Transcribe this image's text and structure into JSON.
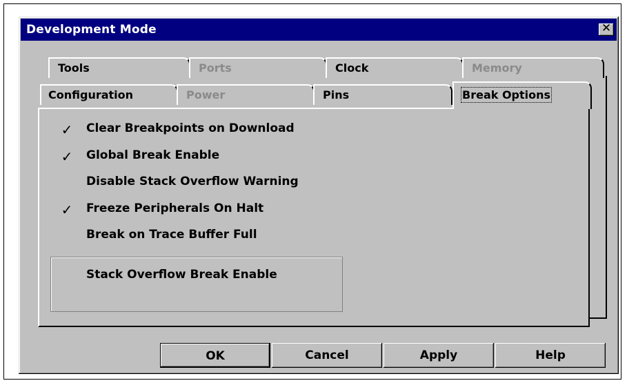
{
  "dialog": {
    "title": "Development Mode",
    "close_glyph": "✕"
  },
  "tabs": {
    "back_row": [
      {
        "label": "Tools",
        "enabled": true
      },
      {
        "label": "Ports",
        "enabled": false
      },
      {
        "label": "Clock",
        "enabled": true
      },
      {
        "label": "Memory",
        "enabled": false
      }
    ],
    "front_row": [
      {
        "label": "Configuration",
        "enabled": true
      },
      {
        "label": "Power",
        "enabled": false
      },
      {
        "label": "Pins",
        "enabled": true
      },
      {
        "label": "Break Options",
        "enabled": true,
        "selected": true
      }
    ]
  },
  "options": [
    {
      "label": "Clear Breakpoints on Download",
      "checked": true
    },
    {
      "label": "Global Break Enable",
      "checked": true
    },
    {
      "label": "Disable Stack Overflow Warning",
      "checked": false
    },
    {
      "label": "Freeze Peripherals On Halt",
      "checked": true
    },
    {
      "label": "Break on Trace Buffer Full",
      "checked": false
    }
  ],
  "group_option": {
    "label": "Stack Overflow Break Enable",
    "checked": false
  },
  "check_glyph": "✓",
  "buttons": {
    "ok": "OK",
    "cancel": "Cancel",
    "apply": "Apply",
    "help": "Help"
  }
}
